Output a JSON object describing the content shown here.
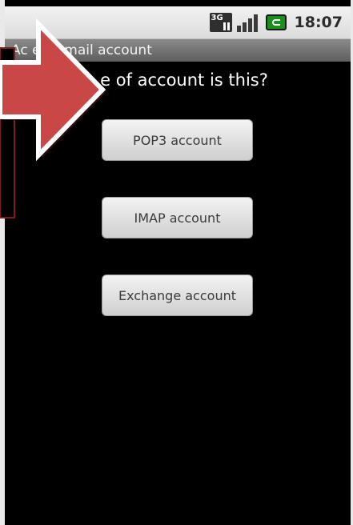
{
  "status_bar": {
    "time": "18:07",
    "network_label": "3G",
    "icons": [
      "3g-data-icon",
      "signal-strength-icon",
      "battery-icon"
    ]
  },
  "title_bar": {
    "title_visible": "Ac     ew email account"
  },
  "main": {
    "question_visible": "e of account is this?",
    "buttons": [
      {
        "label": "POP3 account"
      },
      {
        "label": "IMAP account"
      },
      {
        "label": "Exchange account"
      }
    ]
  },
  "annotation": {
    "type": "red-arrow-pointer",
    "color": "#c94747",
    "outline": "#ffffff"
  }
}
